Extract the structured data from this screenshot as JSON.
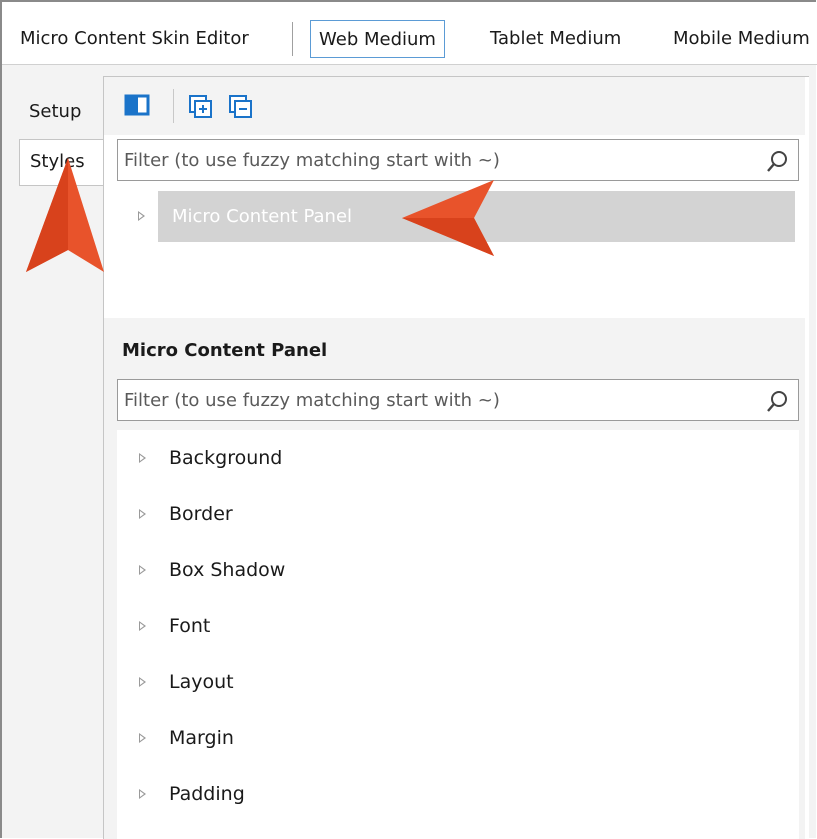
{
  "header": {
    "title": "Micro Content Skin Editor",
    "tabs": [
      {
        "label": "Web Medium",
        "active": true
      },
      {
        "label": "Tablet Medium",
        "active": false
      },
      {
        "label": "Mobile Medium",
        "active": false
      }
    ]
  },
  "side_tabs": [
    {
      "label": "Setup",
      "active": false
    },
    {
      "label": "Styles",
      "active": true
    }
  ],
  "toolbar": {
    "icons": [
      "panel-toggle-icon",
      "expand-all-icon",
      "collapse-all-icon"
    ]
  },
  "top_filter": {
    "placeholder": "Filter (to use fuzzy matching start with ~)",
    "value": ""
  },
  "tree": {
    "items": [
      {
        "label": "Micro Content Panel",
        "selected": true
      }
    ]
  },
  "properties": {
    "section_title": "Micro Content Panel",
    "filter": {
      "placeholder": "Filter (to use fuzzy matching start with ~)",
      "value": ""
    },
    "items": [
      {
        "label": "Background"
      },
      {
        "label": "Border"
      },
      {
        "label": "Box Shadow"
      },
      {
        "label": "Font"
      },
      {
        "label": "Layout"
      },
      {
        "label": "Margin"
      },
      {
        "label": "Padding"
      }
    ]
  },
  "colors": {
    "accent_blue": "#1a73c9",
    "callout_orange": "#e8532b",
    "selection_gray": "#d3d3d3",
    "active_tab_border": "#5b9bd5"
  }
}
